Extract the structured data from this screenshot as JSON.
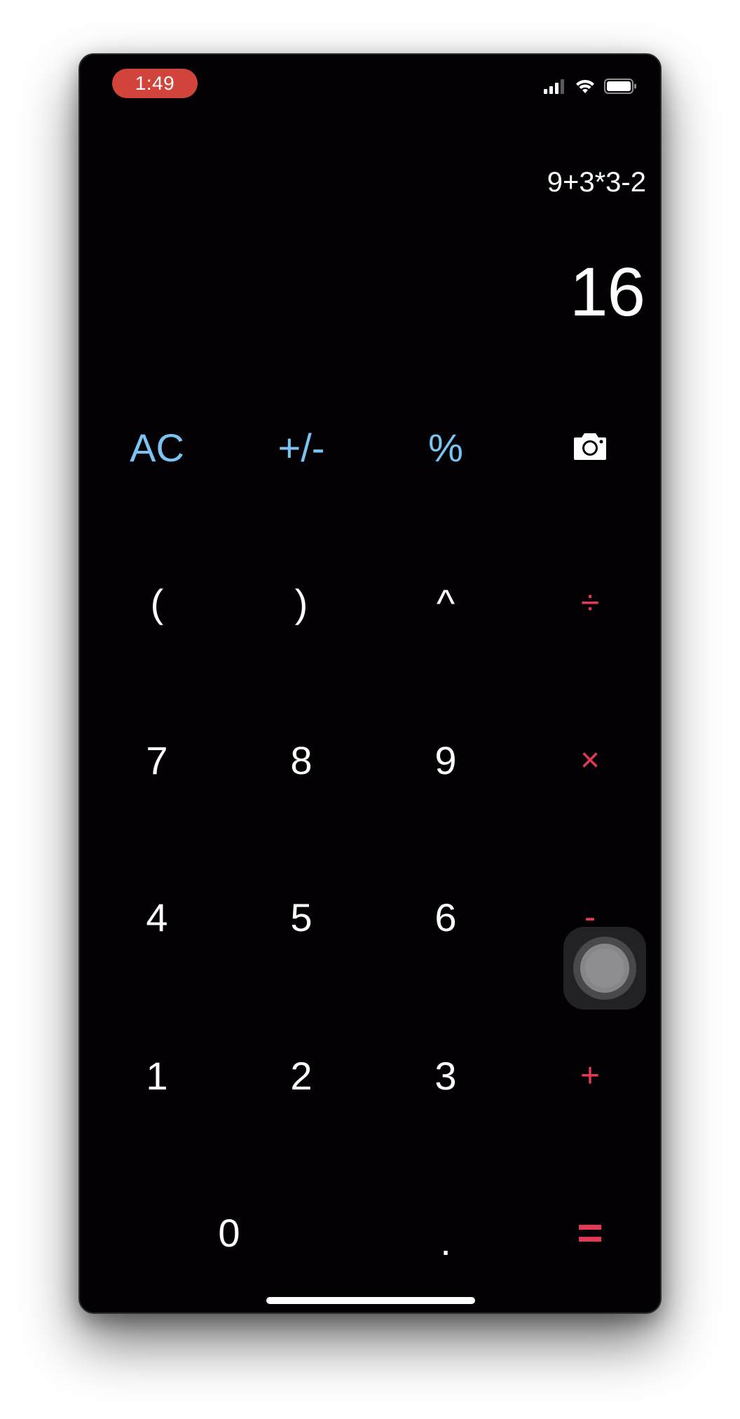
{
  "status_bar": {
    "time": "1:49",
    "signal_icon": "cellular-signal-icon",
    "wifi_icon": "wifi-icon",
    "battery_icon": "battery-icon"
  },
  "display": {
    "expression": "9+3*3-2",
    "result": "16"
  },
  "keys": {
    "ac": "AC",
    "plus_minus": "+/-",
    "percent": "%",
    "camera_icon": "camera-icon",
    "open_paren": "(",
    "close_paren": ")",
    "power": "^",
    "divide": "÷",
    "seven": "7",
    "eight": "8",
    "nine": "9",
    "multiply": "×",
    "four": "4",
    "five": "5",
    "six": "6",
    "subtract": "-",
    "one": "1",
    "two": "2",
    "three": "3",
    "add": "+",
    "zero": "0",
    "decimal": ".",
    "equals": "="
  },
  "colors": {
    "background": "#040104",
    "function_keys": "#79c4f2",
    "operator_keys": "#e23a55",
    "digit_keys": "#ffffff",
    "time_pill": "#d0443b"
  }
}
